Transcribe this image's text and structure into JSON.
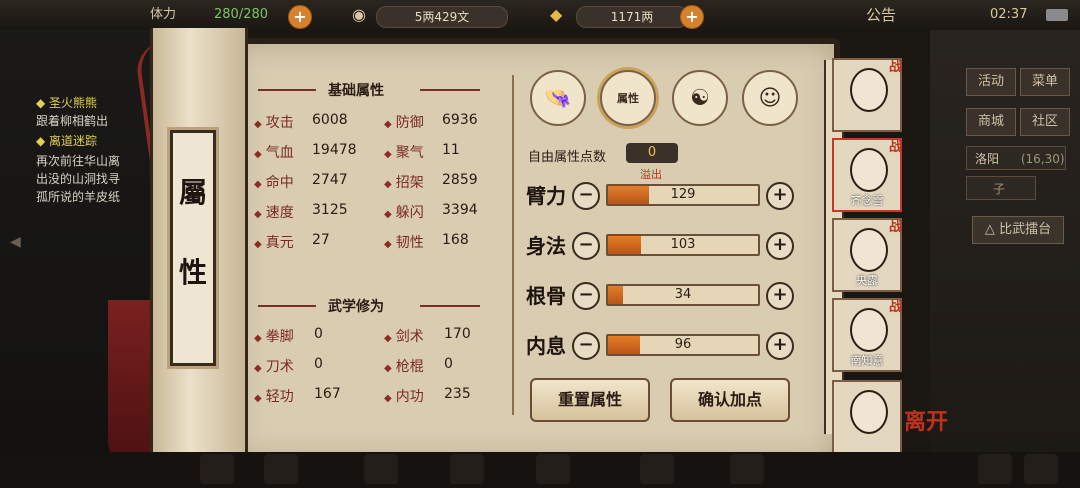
{
  "topbar": {
    "stamina_label": "体力",
    "stamina": "280/280",
    "money": "5两429文",
    "gold": "1171两",
    "notice": "公告",
    "clock": "02:37"
  },
  "left_panel": {
    "quest1_title": "圣火熊熊",
    "quest1_desc": "跟着柳相鹤出",
    "quest2_title": "离道迷踪",
    "quest2_line1": "再次前往华山离",
    "quest2_line2": "出没的山洞找寻",
    "quest2_line3": "孤所说的羊皮纸"
  },
  "scroll": {
    "title_char1": "屬",
    "title_char2": "性"
  },
  "basic": {
    "heading": "基础属性",
    "stats": [
      {
        "label": "攻击",
        "value": "6008"
      },
      {
        "label": "防御",
        "value": "6936"
      },
      {
        "label": "气血",
        "value": "19478"
      },
      {
        "label": "聚气",
        "value": "11"
      },
      {
        "label": "命中",
        "value": "2747"
      },
      {
        "label": "招架",
        "value": "2859"
      },
      {
        "label": "速度",
        "value": "3125"
      },
      {
        "label": "躲闪",
        "value": "3394"
      },
      {
        "label": "真元",
        "value": "27"
      },
      {
        "label": "韧性",
        "value": "168"
      }
    ]
  },
  "martial": {
    "heading": "武学修为",
    "stats": [
      {
        "label": "拳脚",
        "value": "0"
      },
      {
        "label": "剑术",
        "value": "170"
      },
      {
        "label": "刀术",
        "value": "0"
      },
      {
        "label": "枪棍",
        "value": "0"
      },
      {
        "label": "轻功",
        "value": "167"
      },
      {
        "label": "内功",
        "value": "235"
      }
    ]
  },
  "tabs": {
    "attr_tag": "属性"
  },
  "attributes": {
    "free_points_label": "自由属性点数",
    "free_points": "0",
    "overflow": "溢出",
    "rows": [
      {
        "name": "臂力",
        "value": "129",
        "fill": 0.27
      },
      {
        "name": "身法",
        "value": "103",
        "fill": 0.22
      },
      {
        "name": "根骨",
        "value": "34",
        "fill": 0.1
      },
      {
        "name": "内息",
        "value": "96",
        "fill": 0.21
      }
    ],
    "reset_label": "重置属性",
    "confirm_label": "确认加点"
  },
  "characters": [
    {
      "name": "",
      "battle": "战"
    },
    {
      "name": "齐念雪",
      "battle": "战"
    },
    {
      "name": "央露",
      "battle": "战"
    },
    {
      "name": "南知意",
      "battle": "战"
    },
    {
      "name": "",
      "battle": ""
    }
  ],
  "leave": "离开",
  "right_panel": {
    "activity": "活动",
    "menu": "菜单",
    "shop": "商城",
    "community": "社区",
    "location": "洛阳",
    "coords": "(16,30)",
    "time": "子",
    "arena": "比武擂台"
  },
  "colors": {
    "accent": "#e57d25",
    "battle_red": "#c0321c",
    "parchment": "#d9ccb1"
  }
}
